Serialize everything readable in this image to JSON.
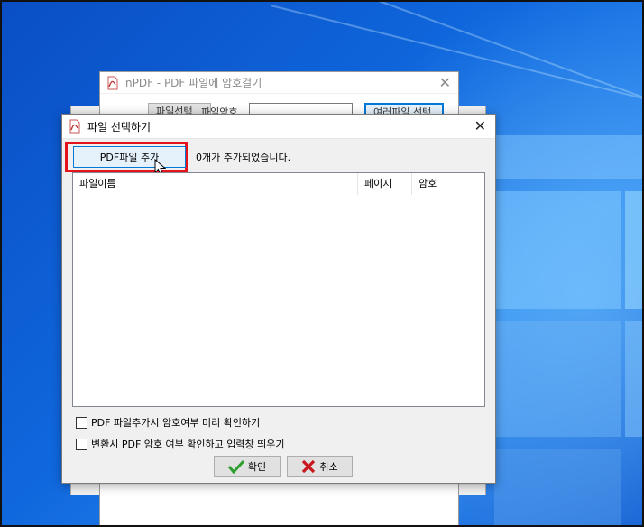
{
  "back_window": {
    "title": "nPDF - PDF 파일에 암호걸기",
    "toolbar": {
      "select_file_label": "파일선택",
      "password_label": "파일암호",
      "multi_select_label": "여러파일 선택"
    }
  },
  "dialog": {
    "title": "파일 선택하기",
    "add_pdf_label": "PDF파일 추가",
    "file_count_text": "0개가 추가되었습니다.",
    "columns": [
      {
        "label": "파일이름"
      },
      {
        "label": "페이지"
      },
      {
        "label": "암호"
      }
    ],
    "options": [
      {
        "label": "PDF 파일추가시 암호여부 미리 확인하기",
        "checked": false
      },
      {
        "label": "변환시 PDF 암호 여부 확인하고 입력창 띄우기",
        "checked": false
      }
    ],
    "ok_label": "확인",
    "cancel_label": "취소"
  },
  "colors": {
    "accent_blue": "#0078d7",
    "highlight_red": "#e3141c",
    "ok_green": "#2e9e2e",
    "cancel_red": "#c8161d"
  },
  "icons": [
    "pdf-app-icon",
    "close-icon",
    "mouse-cursor-icon",
    "check-icon",
    "cross-icon"
  ]
}
